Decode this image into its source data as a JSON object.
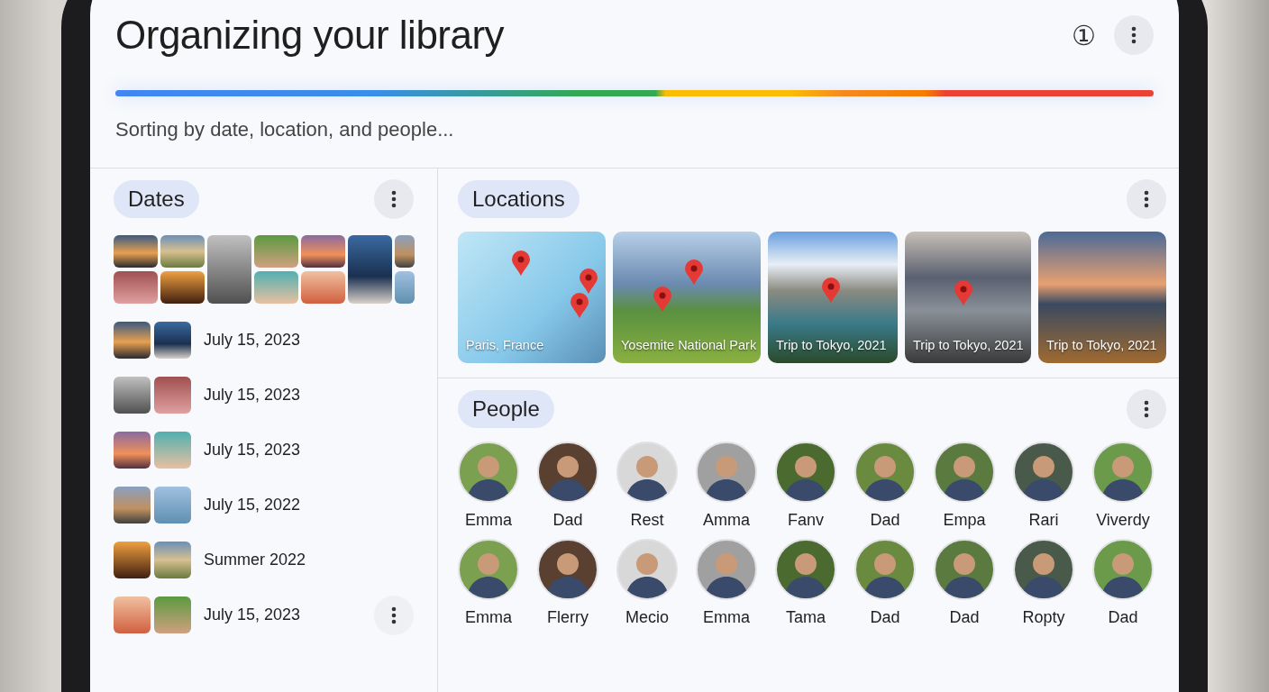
{
  "header": {
    "title": "Organizing your library",
    "info_icon": "①",
    "status": "Sorting by date, location, and people..."
  },
  "dates": {
    "label": "Dates",
    "rows": [
      {
        "label": "July 15, 2023",
        "has_menu": false
      },
      {
        "label": "July 15, 2023",
        "has_menu": false
      },
      {
        "label": "July 15, 2023",
        "has_menu": false
      },
      {
        "label": "July 15, 2022",
        "has_menu": false
      },
      {
        "label": "Summer 2022",
        "has_menu": false
      },
      {
        "label": "July 15, 2023",
        "has_menu": true
      }
    ]
  },
  "locations": {
    "label": "Locations",
    "cards": [
      {
        "label": "Paris, France",
        "kind": "map"
      },
      {
        "label": "Yosemite National Park",
        "kind": "photo"
      },
      {
        "label": "Trip to Tokyo, 2021",
        "kind": "photo"
      },
      {
        "label": "Trip to Tokyo, 2021",
        "kind": "photo"
      },
      {
        "label": "Trip to Tokyo, 2021",
        "kind": "photo"
      }
    ]
  },
  "people": {
    "label": "People",
    "names": [
      "Emma",
      "Dad",
      "Rest",
      "Amma",
      "Fanv",
      "Dad",
      "Empa",
      "Rari",
      "Viverdy",
      "Emma",
      "Flerry",
      "Mecio",
      "Emma",
      "Tama",
      "Dad",
      "Dad",
      "Ropty",
      "Dad"
    ]
  }
}
